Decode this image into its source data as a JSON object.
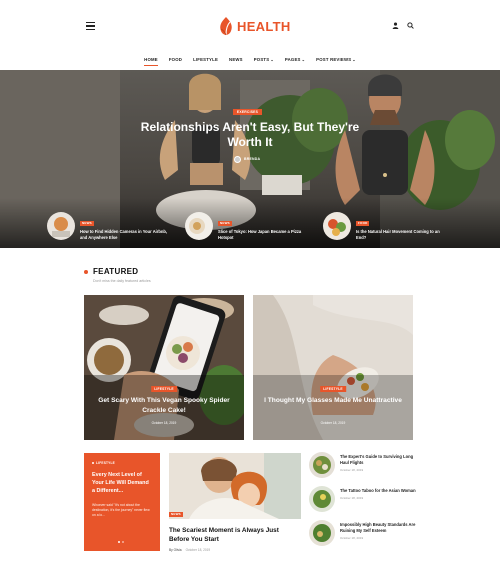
{
  "brand": {
    "name": "HEALTH",
    "accent": "#e8552a"
  },
  "header": {
    "icons": [
      "menu-icon",
      "user-icon",
      "search-icon"
    ]
  },
  "nav": {
    "items": [
      {
        "label": "HOME",
        "caret": false,
        "active": true
      },
      {
        "label": "FOOD",
        "caret": false,
        "active": false
      },
      {
        "label": "LIFESTYLE",
        "caret": false,
        "active": false
      },
      {
        "label": "NEWS",
        "caret": false,
        "active": false
      },
      {
        "label": "POSTS",
        "caret": true,
        "active": false
      },
      {
        "label": "PAGES",
        "caret": true,
        "active": false
      },
      {
        "label": "POST REVIEWS",
        "caret": true,
        "active": false
      }
    ],
    "caret_glyph": "⌄"
  },
  "hero": {
    "badge": "EXERCISES",
    "title": "Relationships Aren't Easy, But They're Worth It",
    "author": "BRENDA"
  },
  "hero_items": [
    {
      "badge": "NEWS",
      "title": "How to Find Hidden Cameras in Your Airbnb, and Anywhere Else"
    },
    {
      "badge": "NEWS",
      "title": "Slice of Tokyo: How Japan Became a Pizza Hotspot"
    },
    {
      "badge": "FOOD",
      "title": "Is the Natural Hair Movement Coming to an End?"
    }
  ],
  "featured": {
    "title": "FEATURED",
    "subtitle": "Don't miss the daily featured articles"
  },
  "featured_cards": [
    {
      "badge": "LIFESTYLE",
      "title": "Get Scary With This Vegan Spooky Spider Crackle Cake!",
      "date": "October 18, 2019"
    },
    {
      "badge": "LIFESTYLE",
      "title": "I Thought My Glasses Made Me Unattractive",
      "date": "October 18, 2019"
    }
  ],
  "orange_card": {
    "category": "LIFESTYLE",
    "title": "Every Next Level of Your Life Will Demand a Different...",
    "text": "Whoever said \"It's not about the destination, it's the journey\" never flew on a lo..."
  },
  "mid_card": {
    "badge": "NEWS",
    "title": "The Scariest Moment is Always Just Before You Start",
    "author": "By Olivia",
    "date": "October 18, 2019"
  },
  "side_items": [
    {
      "title": "The Expert's Guide to Surviving Long Haul Flights",
      "date": "October 18, 2019"
    },
    {
      "title": "The Tattoo Taboo for the Asian Woman",
      "date": "October 18, 2019"
    },
    {
      "title": "Impossibly High Beauty Standards Are Ruining My Self Esteem",
      "date": "October 18, 2019"
    }
  ]
}
